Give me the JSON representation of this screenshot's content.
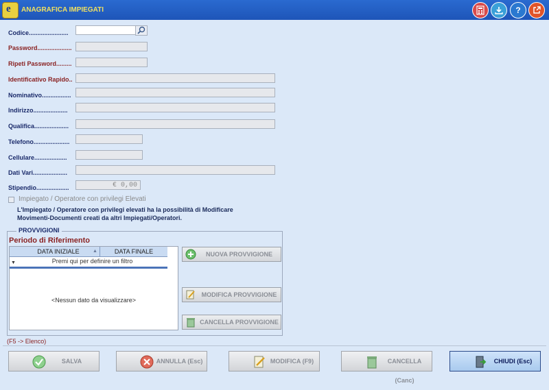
{
  "window": {
    "title": "ANAGRAFICA IMPIEGATI"
  },
  "toolbar": {
    "app_icon_letter": "e",
    "help_glyph": "?"
  },
  "form": {
    "codice_label": "Codice.......................",
    "password_label": "Password....................",
    "ripeti_label": "Ripeti Password.........",
    "identificativo_label": "Identificativo Rapido..",
    "nominativo_label": "Nominativo.................",
    "indirizzo_label": "Indirizzo....................",
    "qualifica_label": "Qualifica....................",
    "telefono_label": "Telefono.....................",
    "cellulare_label": "Cellulare...................",
    "dati_vari_label": "Dati Vari....................",
    "stipendio_label": "Stipendio...................",
    "stipendio_value": "€ 0,00"
  },
  "privileges": {
    "checkbox_label": "Impiegato / Operatore con privilegi Elevati",
    "note_line1": "L'Impiegato / Operatore con privilegi elevati ha la possibilità di Modificare",
    "note_line2": "Movimenti-Documenti creati da altri Impiegati/Operatori."
  },
  "provvigioni": {
    "group_title": "PROVVIGIONI",
    "period_title": "Periodo di Riferimento",
    "col_start": "DATA INIZIALE",
    "col_end": "DATA FINALE",
    "filter_placeholder": "Premi qui per definire un filtro",
    "empty_text": "<Nessun dato da visualizzare>",
    "btn_new": "NUOVA PROVVIGIONE",
    "btn_edit": "MODIFICA PROVVIGIONE",
    "btn_delete": "CANCELLA PROVVIGIONE"
  },
  "footer": {
    "hint": "(F5 -> Elenco)",
    "salva": "SALVA",
    "annulla": "ANNULLA (Esc)",
    "modifica": "MODIFICA  (F9)",
    "cancella": "CANCELLA  (Canc)",
    "chiudi": "CHIUDI  (Esc)"
  },
  "colors": {
    "titlebar": "#1e55b8",
    "background": "#dbe8f8",
    "label_blue": "#1a2a6a",
    "label_red": "#8a2222"
  }
}
